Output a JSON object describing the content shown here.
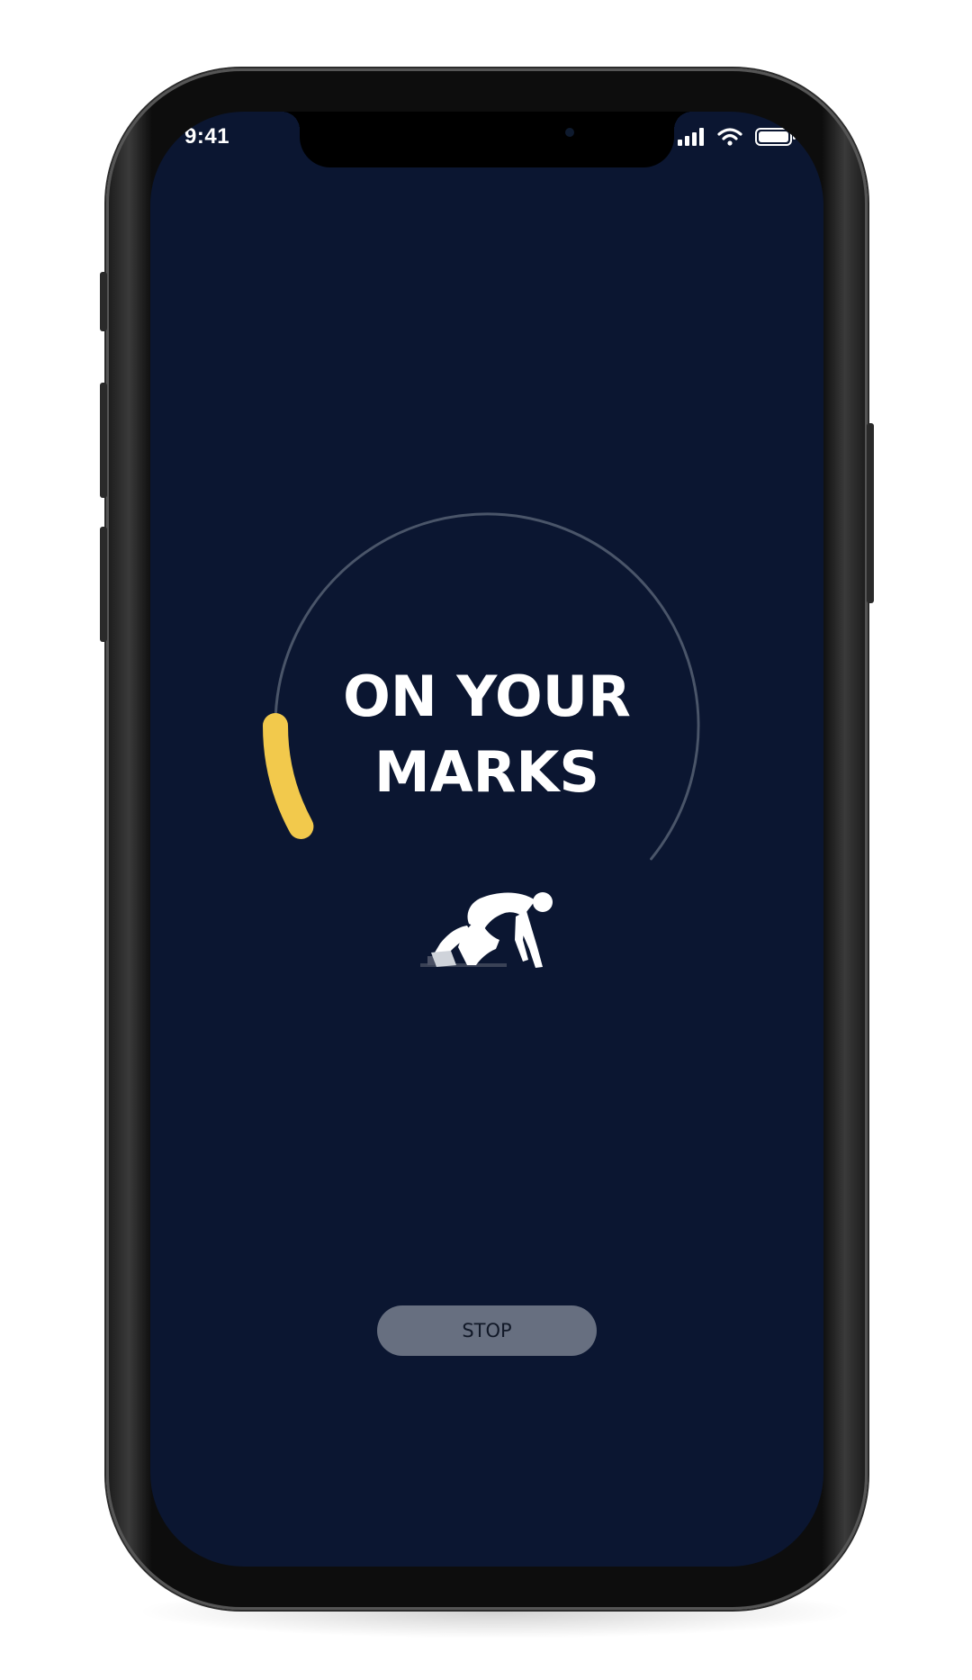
{
  "status_bar": {
    "time": "9:41",
    "icons": [
      "signal-icon",
      "wifi-icon",
      "battery-icon"
    ]
  },
  "countdown": {
    "line1": "ON YOUR",
    "line2": "MARKS",
    "progress_fraction": 0.13,
    "ring_color": "#4a5569",
    "progress_color": "#f2c94c"
  },
  "illustration": {
    "icon": "sprinter-crouch-icon"
  },
  "controls": {
    "stop_label": "STOP"
  },
  "colors": {
    "screen_bg": "#0b1631",
    "button_bg": "#676f80",
    "text": "#ffffff"
  }
}
